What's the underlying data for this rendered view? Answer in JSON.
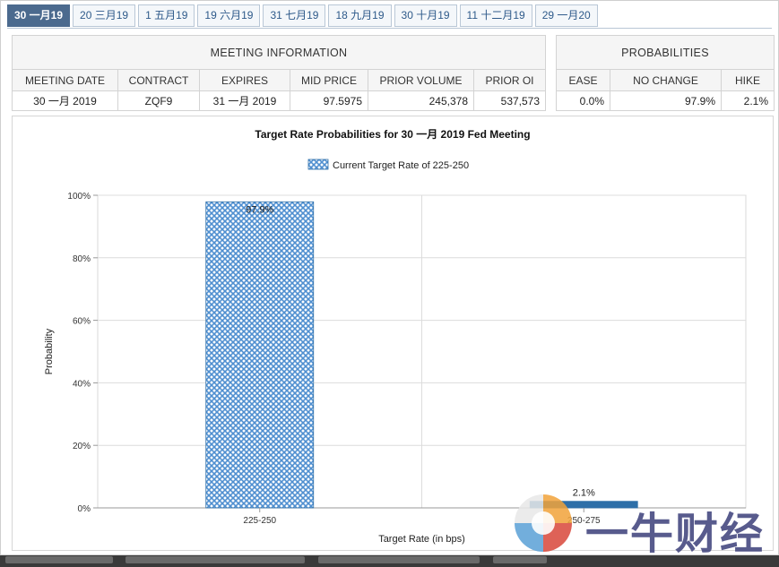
{
  "tabs": [
    {
      "label": "30 一月19",
      "active": true
    },
    {
      "label": "20 三月19",
      "active": false
    },
    {
      "label": "1 五月19",
      "active": false
    },
    {
      "label": "19 六月19",
      "active": false
    },
    {
      "label": "31 七月19",
      "active": false
    },
    {
      "label": "18 九月19",
      "active": false
    },
    {
      "label": "30 十月19",
      "active": false
    },
    {
      "label": "11 十二月19",
      "active": false
    },
    {
      "label": "29 一月20",
      "active": false
    }
  ],
  "meeting_info": {
    "caption": "MEETING INFORMATION",
    "headers": [
      "MEETING DATE",
      "CONTRACT",
      "EXPIRES",
      "MID PRICE",
      "PRIOR VOLUME",
      "PRIOR OI"
    ],
    "row": [
      "30 一月 2019",
      "ZQF9",
      "31 一月 2019",
      "97.5975",
      "245,378",
      "537,573"
    ]
  },
  "probabilities": {
    "caption": "PROBABILITIES",
    "headers": [
      "EASE",
      "NO CHANGE",
      "HIKE"
    ],
    "row": [
      "0.0%",
      "97.9%",
      "2.1%"
    ]
  },
  "chart_data": {
    "type": "bar",
    "title": "Target Rate Probabilities for 30 一月 2019 Fed Meeting",
    "legend": "Current Target Rate of 225-250",
    "xlabel": "Target Rate (in bps)",
    "ylabel": "Probability",
    "categories": [
      "225-250",
      "250-275"
    ],
    "values": [
      97.9,
      2.1
    ],
    "value_labels": [
      "97.9%",
      "2.1%"
    ],
    "ylim": [
      0,
      100
    ],
    "yticks": [
      "0%",
      "20%",
      "40%",
      "60%",
      "80%",
      "100%"
    ],
    "grid": true,
    "colors": {
      "current": "#4f8fd0",
      "other": "#2e6fa8"
    }
  },
  "watermark": {
    "text": "一牛财经"
  }
}
